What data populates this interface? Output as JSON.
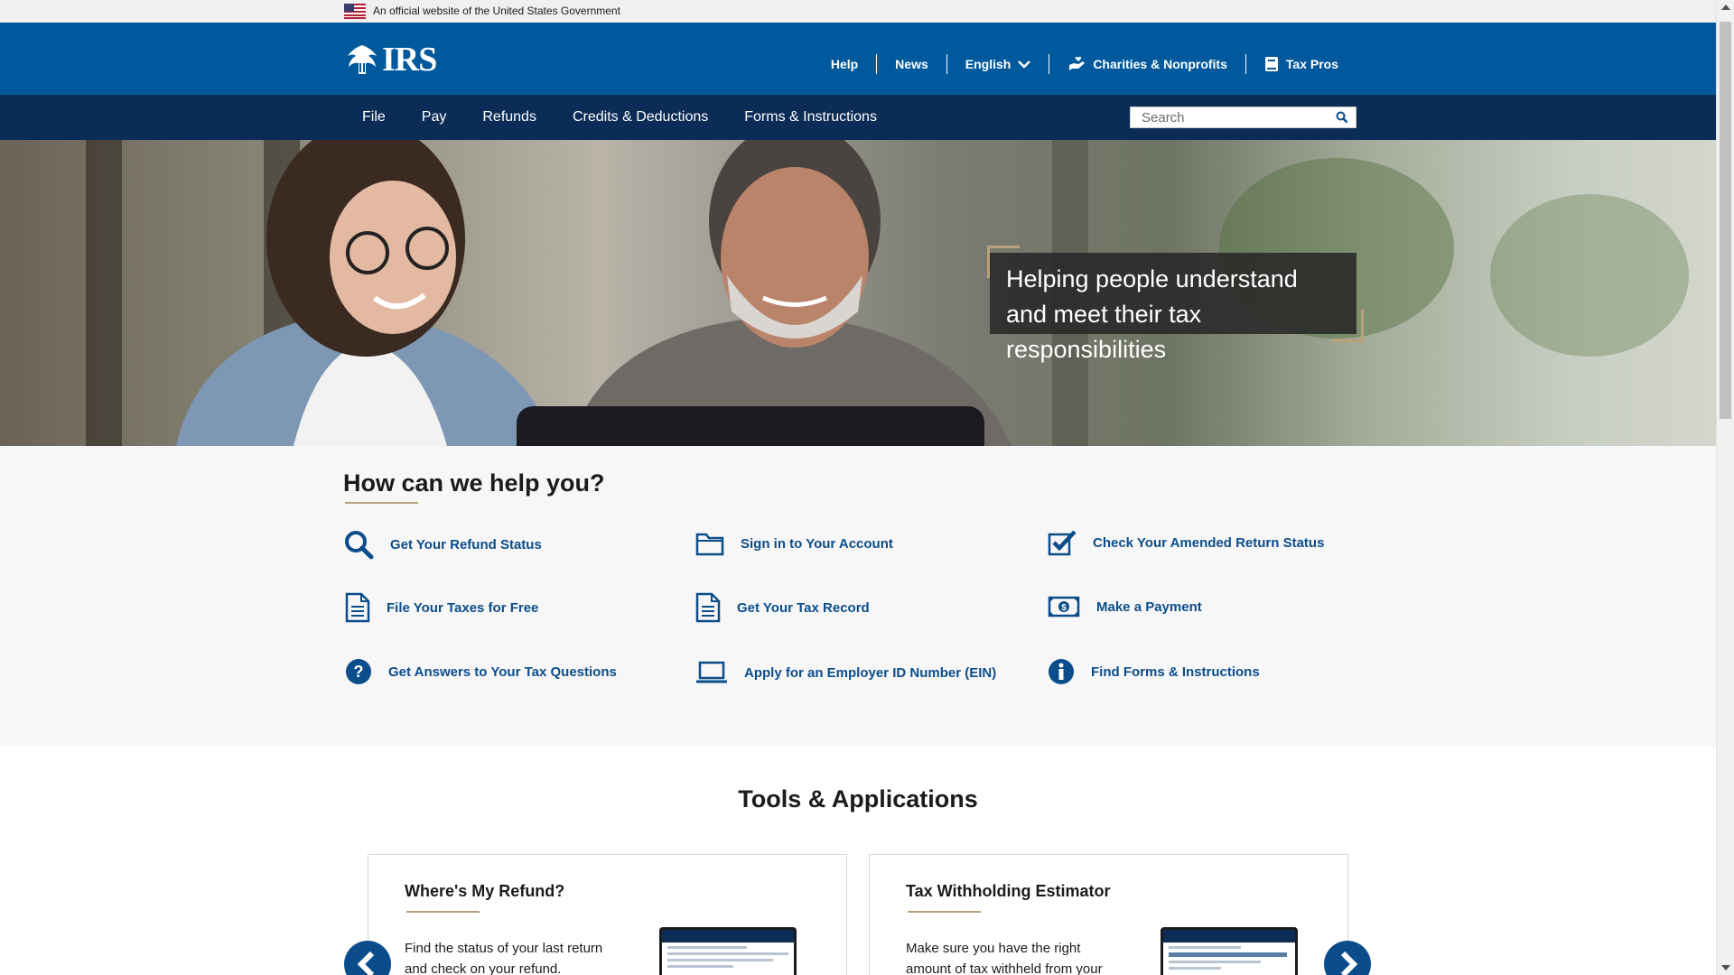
{
  "gov_banner": {
    "text": "An official website of the United States Government"
  },
  "header": {
    "logo_text": "IRS",
    "util_nav": [
      {
        "label": "Help"
      },
      {
        "label": "News"
      },
      {
        "label": "English"
      },
      {
        "label": "Charities & Nonprofits"
      },
      {
        "label": "Tax Pros"
      }
    ]
  },
  "main_nav": {
    "links": [
      "File",
      "Pay",
      "Refunds",
      "Credits & Deductions",
      "Forms & Instructions"
    ],
    "search_placeholder": "Search"
  },
  "hero": {
    "callout": "Helping people understand and meet their tax responsibilities"
  },
  "help": {
    "heading": "How can we help you?",
    "items": [
      {
        "label": "Get Your Refund Status",
        "icon": "search-icon"
      },
      {
        "label": "Sign in to Your Account",
        "icon": "folder-icon"
      },
      {
        "label": "Check Your Amended Return Status",
        "icon": "checkbox-icon"
      },
      {
        "label": "File Your Taxes for Free",
        "icon": "document-icon"
      },
      {
        "label": "Get Your Tax Record",
        "icon": "document-icon"
      },
      {
        "label": "Make a Payment",
        "icon": "money-icon"
      },
      {
        "label": "Get Answers to Your Tax Questions",
        "icon": "question-icon"
      },
      {
        "label": "Apply for an Employer ID Number (EIN)",
        "icon": "laptop-icon"
      },
      {
        "label": "Find Forms & Instructions",
        "icon": "info-icon"
      }
    ]
  },
  "tools": {
    "heading": "Tools & Applications",
    "cards": [
      {
        "title": "Where's My Refund?",
        "text": "Find the status of your last return and check on your refund."
      },
      {
        "title": "Tax Withholding Estimator",
        "text": "Make sure you have the right amount of tax withheld from your"
      }
    ]
  },
  "colors": {
    "header_blue": "#00599c",
    "nav_navy": "#0b2c56",
    "link_blue": "#0b4d8a",
    "accent_gold": "#b9a27a"
  }
}
